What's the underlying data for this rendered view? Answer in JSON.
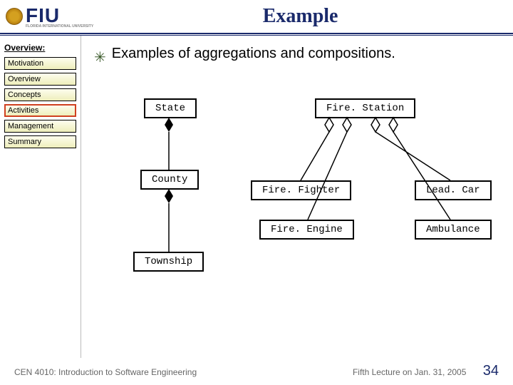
{
  "header": {
    "logo_text": "FIU",
    "logo_sub": "FLORIDA INTERNATIONAL UNIVERSITY",
    "title": "Example"
  },
  "sidebar": {
    "section_label": "Overview:",
    "items": [
      {
        "label": "Motivation"
      },
      {
        "label": "Overview"
      },
      {
        "label": "Concepts"
      },
      {
        "label": "Activities"
      },
      {
        "label": "Management"
      },
      {
        "label": "Summary"
      }
    ],
    "active_index": 3
  },
  "content": {
    "bullet_text": "Examples of aggregations and compositions."
  },
  "diagram": {
    "boxes": {
      "state": "State",
      "county": "County",
      "township": "Township",
      "firestation": "Fire. Station",
      "firefighter": "Fire. Fighter",
      "fireengine": "Fire. Engine",
      "leadcar": "Lead. Car",
      "ambulance": "Ambulance"
    },
    "relations": [
      {
        "from": "State",
        "to": "County",
        "type": "composition"
      },
      {
        "from": "County",
        "to": "Township",
        "type": "composition"
      },
      {
        "from": "Fire. Station",
        "to": "Fire. Fighter",
        "type": "aggregation"
      },
      {
        "from": "Fire. Station",
        "to": "Fire. Engine",
        "type": "aggregation"
      },
      {
        "from": "Fire. Station",
        "to": "Lead. Car",
        "type": "aggregation"
      },
      {
        "from": "Fire. Station",
        "to": "Ambulance",
        "type": "aggregation"
      }
    ]
  },
  "footer": {
    "left": "CEN 4010: Introduction to Software Engineering",
    "right": "Fifth Lecture on Jan. 31, 2005",
    "page": "34"
  }
}
